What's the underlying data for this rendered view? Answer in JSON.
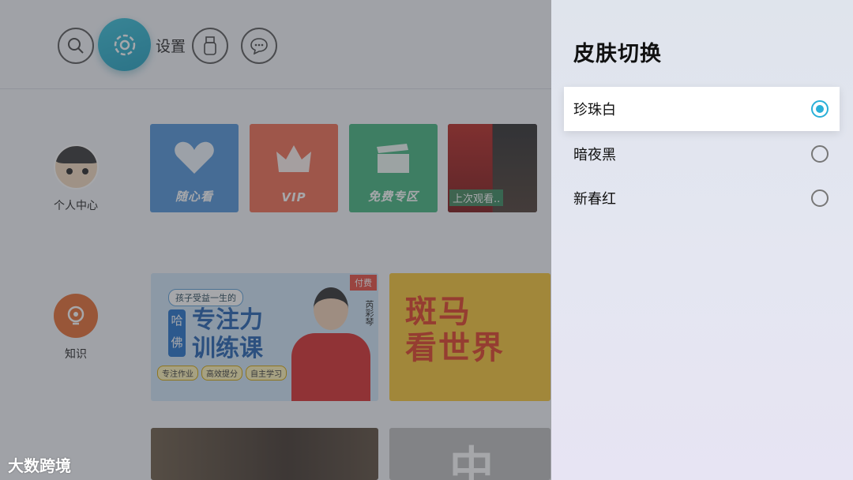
{
  "topbar": {
    "settings_label": "设置",
    "icons": [
      "search-icon",
      "gear-icon",
      "usb-icon",
      "message-icon"
    ]
  },
  "sidebar": {
    "items": [
      {
        "label": "个人中心",
        "icon": "avatar"
      },
      {
        "label": "知识",
        "icon": "lightbulb-icon"
      }
    ]
  },
  "tiles": [
    {
      "label": "随心看",
      "icon": "heart-icon",
      "color": "#4e93d8"
    },
    {
      "label": "VIP",
      "icon": "crown-icon",
      "color": "#f06a4e"
    },
    {
      "label": "免费专区",
      "icon": "clapper-icon",
      "color": "#3fb47c"
    },
    {
      "label": "上次观看..",
      "icon": "poster"
    }
  ],
  "banners": {
    "course": {
      "tag": "付费",
      "subtitle": "孩子受益一生的",
      "school": "哈佛",
      "title_line1": "专注力",
      "title_line2": "训练课",
      "pills": [
        "专注作业",
        "高效提分",
        "自主学习"
      ],
      "presenter": "芮彩琴"
    },
    "zebra": {
      "title_line1": "斑马",
      "title_line2": "看世界"
    },
    "photo_b_text": "中"
  },
  "watermark": "大数跨境",
  "skin_panel": {
    "title": "皮肤切换",
    "options": [
      {
        "label": "珍珠白",
        "selected": true
      },
      {
        "label": "暗夜黑",
        "selected": false
      },
      {
        "label": "新春红",
        "selected": false
      }
    ],
    "accent_color": "#2ab0d8"
  }
}
